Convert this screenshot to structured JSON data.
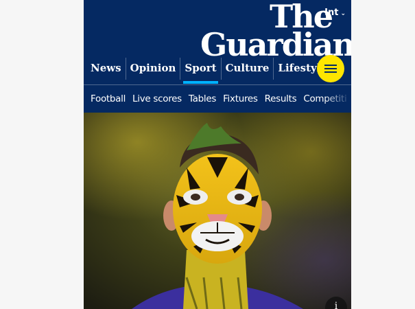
{
  "header": {
    "edition_label": "Int",
    "logo_line1": "The",
    "logo_line2": "Guardian",
    "menu_icon": "hamburger-icon"
  },
  "pillars": [
    {
      "label": "News"
    },
    {
      "label": "Opinion"
    },
    {
      "label": "Sport",
      "active": true
    },
    {
      "label": "Culture"
    },
    {
      "label": "Lifestyle"
    }
  ],
  "subnav": [
    {
      "label": "Football"
    },
    {
      "label": "Live scores"
    },
    {
      "label": "Tables"
    },
    {
      "label": "Fixtures"
    },
    {
      "label": "Results"
    },
    {
      "label": "Competiti"
    }
  ],
  "hero": {
    "image_icon": "info-icon"
  },
  "colors": {
    "brand_blue": "#052962",
    "accent_yellow": "#ffe500",
    "sport_accent": "#00b2ff"
  }
}
